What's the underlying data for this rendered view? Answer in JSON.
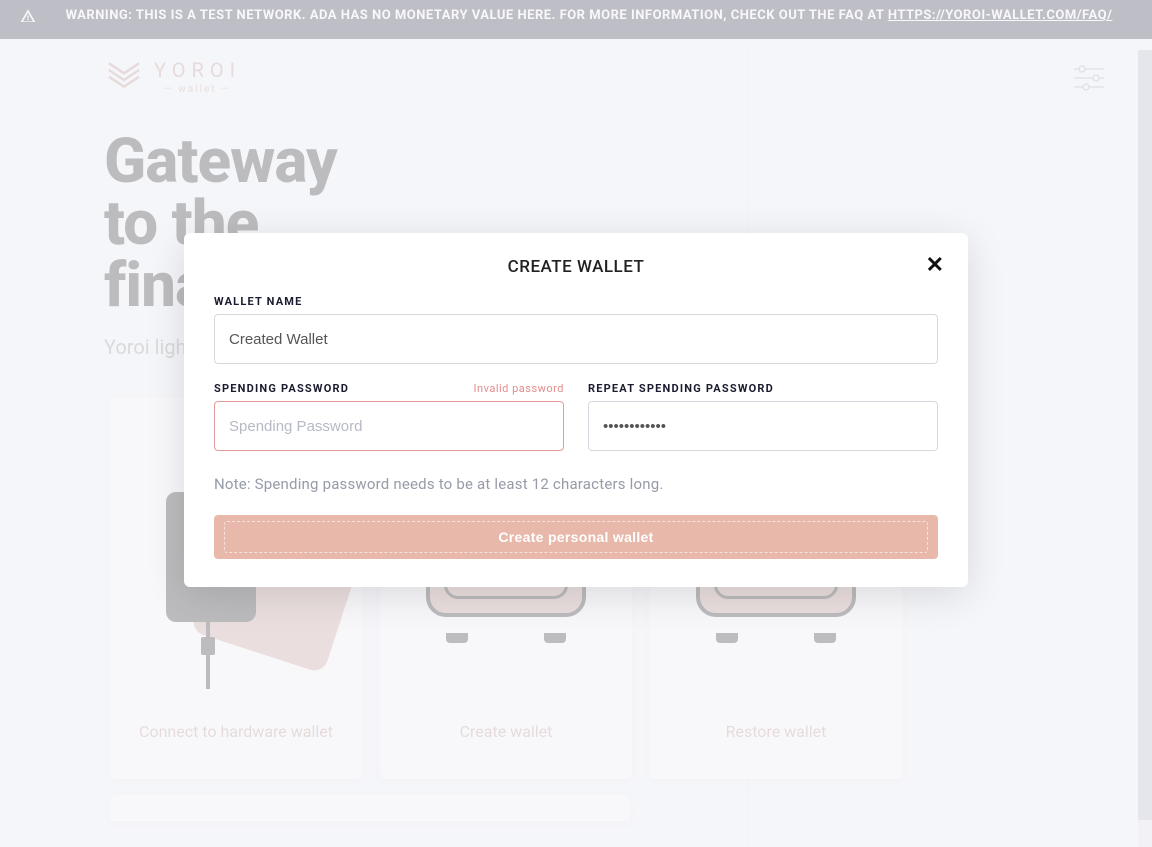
{
  "warning": {
    "text_prefix": "WARNING: THIS IS A TEST NETWORK. ADA HAS NO MONETARY VALUE HERE. FOR MORE INFORMATION, CHECK OUT THE FAQ AT ",
    "link_text": "HTTPS://YOROI-WALLET.COM/FAQ/"
  },
  "brand": {
    "name": "YOROI",
    "sub": "wallet"
  },
  "hero": {
    "line1": "Gateway",
    "line2": "to the",
    "line3": "financial world",
    "subtitle": "Yoroi light wallet for Cardano"
  },
  "cards": {
    "hardware": "Connect to hardware wallet",
    "create": "Create wallet",
    "restore": "Restore wallet"
  },
  "modal": {
    "title": "CREATE WALLET",
    "wallet_name_label": "WALLET NAME",
    "wallet_name_value": "Created Wallet",
    "spending_label": "SPENDING PASSWORD",
    "spending_error": "Invalid password",
    "spending_placeholder": "Spending Password",
    "spending_value": "",
    "repeat_label": "REPEAT SPENDING PASSWORD",
    "repeat_value": "asdfasdfasdf",
    "note": "Note: Spending password needs to be at least 12 characters long.",
    "submit": "Create personal wallet"
  },
  "colors": {
    "accent": "#c89a8c",
    "error": "#e58b8b",
    "dark": "#1a1b2f"
  }
}
